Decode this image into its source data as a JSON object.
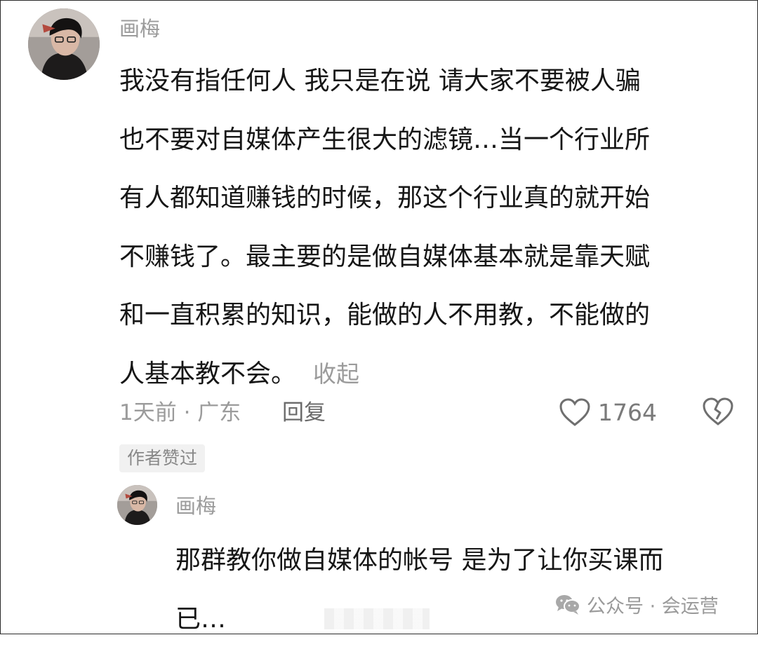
{
  "comment": {
    "username": "画梅",
    "lines": [
      "我没有指任何人 我只是在说 请大家不要被人骗",
      "也不要对自媒体产生很大的滤镜…当一个行业所",
      "有人都知道赚钱的时候，那这个行业真的就开始",
      "不赚钱了。最主要的是做自媒体基本就是靠天赋",
      "和一直积累的知识，能做的人不用教，不能做的",
      "人基本教不会。"
    ],
    "collapse_label": "收起",
    "time_location": "1天前 · 广东",
    "reply_label": "回复",
    "like_count": "1764",
    "author_liked_badge": "作者赞过"
  },
  "reply": {
    "username": "画梅",
    "lines": [
      "那群教你做自媒体的帐号 是为了让你买课而",
      "已…"
    ]
  },
  "watermark": {
    "text": "公众号 · 会运营"
  },
  "icons": {
    "like": "heart-outline-icon",
    "dislike": "broken-heart-icon",
    "watermark": "wechat-icon"
  }
}
